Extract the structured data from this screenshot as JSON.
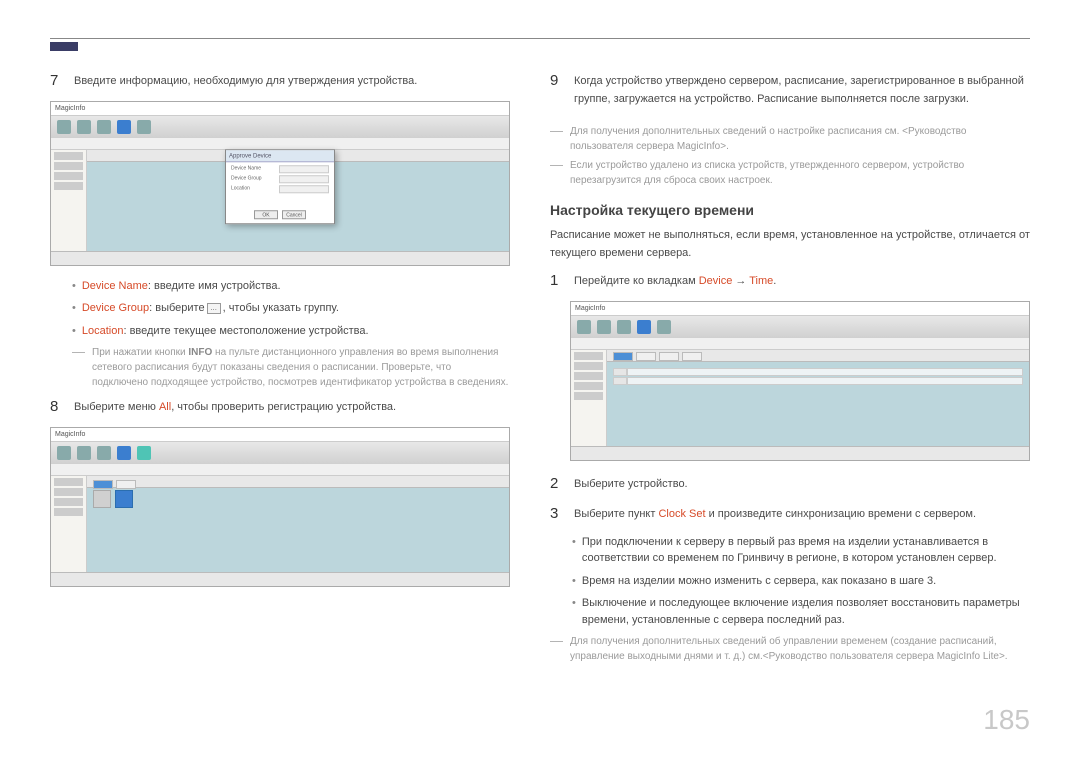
{
  "page_number": "185",
  "left": {
    "step7": {
      "num": "7",
      "text": "Введите информацию, необходимую для утверждения устройства."
    },
    "bullets": [
      {
        "label": "Device Name",
        "text": ": введите имя устройства."
      },
      {
        "label": "Device Group",
        "text_before": ": выберите",
        "text_after": ", чтобы указать группу."
      },
      {
        "label": "Location",
        "text": ": введите текущее местоположение устройства."
      }
    ],
    "note_info": {
      "hint_prefix": "При нажатии кнопки ",
      "hint_info": "INFO",
      "hint_rest": " на пульте дистанционного управления во время выполнения сетевого расписания будут показаны сведения о расписании. Проверьте, что подключено подходящее устройство, посмотрев идентификатор устройства в сведениях."
    },
    "step8": {
      "num": "8",
      "text_a": "Выберите меню ",
      "text_all": "All",
      "text_b": ", чтобы проверить регистрацию устройства."
    },
    "screenshot_brand": "MagicInfo",
    "dialog_title": "Approve Device",
    "dialog_btn_ok": "OK",
    "dialog_btn_cancel": "Cancel"
  },
  "right": {
    "step9": {
      "num": "9",
      "text": "Когда устройство утверждено сервером, расписание, зарегистрированное в выбранной группе, загружается на устройство. Расписание выполняется после загрузки."
    },
    "note_a": "Для получения дополнительных сведений о настройке расписания см. <Руководство пользователя сервера MagicInfo>.",
    "note_b": "Если устройство удалено из списка устройств, утвержденного сервером, устройство перезагрузится для сброса своих настроек.",
    "heading": "Настройка текущего времени",
    "intro": "Расписание может не выполняться, если время, установленное на устройстве, отличается от текущего времени сервера.",
    "step1": {
      "num": "1",
      "text_a": "Перейдите ко вкладкам ",
      "device": "Device",
      "arrow": " → ",
      "time": "Time",
      "text_b": "."
    },
    "step2": {
      "num": "2",
      "text": "Выберите устройство."
    },
    "step3": {
      "num": "3",
      "text_a": "Выберите пункт ",
      "clock": "Clock Set",
      "text_b": " и произведите синхронизацию времени с сервером."
    },
    "bullets2": [
      "При подключении к серверу в первый раз время на изделии устанавливается в соответствии со временем по Гринвичу в регионе, в котором установлен сервер.",
      "Время на изделии можно изменить с сервера, как показано в шаге 3.",
      "Выключение и последующее включение изделия позволяет восстановить параметры времени, установленные с сервера последний раз."
    ],
    "note_c": "Для получения дополнительных сведений об управлении временем (создание расписаний, управление выходными днями и т. д.) см.<Руководство пользователя сервера MagicInfo Lite>."
  }
}
